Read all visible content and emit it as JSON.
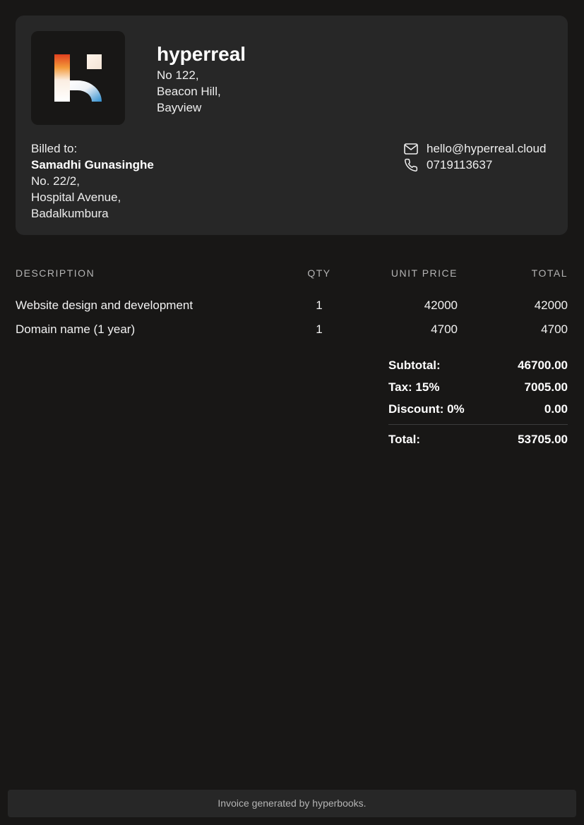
{
  "company": {
    "name": "hyperreal",
    "address": [
      "No 122,",
      "Beacon Hill,",
      "Bayview"
    ],
    "logo_icon": "hyperreal-logo-icon"
  },
  "billed_to": {
    "label": "Billed to:",
    "name": "Samadhi Gunasinghe",
    "address": [
      "No. 22/2,",
      "Hospital Avenue,",
      "Badalkumbura"
    ]
  },
  "contact": {
    "email": "hello@hyperreal.cloud",
    "email_icon": "mail-icon",
    "phone": "0719113637",
    "phone_icon": "phone-icon"
  },
  "items_table": {
    "headers": {
      "description": "DESCRIPTION",
      "qty": "QTY",
      "unit_price": "UNIT PRICE",
      "total": "TOTAL"
    },
    "rows": [
      {
        "description": "Website design and development",
        "qty": "1",
        "unit_price": "42000",
        "total": "42000"
      },
      {
        "description": "Domain name (1 year)",
        "qty": "1",
        "unit_price": "4700",
        "total": "4700"
      }
    ]
  },
  "totals": {
    "subtotal_label": "Subtotal:",
    "subtotal": "46700.00",
    "tax_label": "Tax: 15%",
    "tax": "7005.00",
    "discount_label": "Discount: 0%",
    "discount": "0.00",
    "total_label": "Total:",
    "total": "53705.00"
  },
  "footer": {
    "text": "Invoice generated by hyperbooks."
  },
  "colors": {
    "page_background": "#181716",
    "card_background": "#272727",
    "muted_text": "#b4b4b4",
    "logo_gradient": [
      "#e0401e",
      "#f39a3a",
      "#ffffff",
      "#2f8fd0"
    ]
  }
}
